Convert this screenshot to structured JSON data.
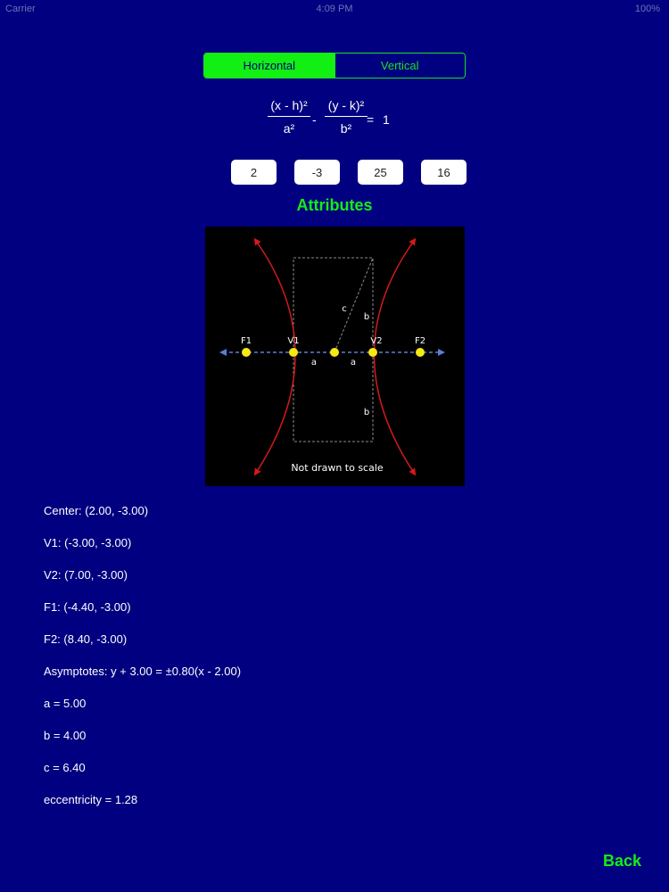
{
  "status": {
    "carrier": "Carrier",
    "time": "4:09 PM",
    "battery": "100%"
  },
  "orientation": {
    "options": [
      "Horizontal",
      "Vertical"
    ],
    "selected": "Horizontal"
  },
  "equation": {
    "term1_numerator": "(x - h)²",
    "term1_denominator": "a²",
    "operator": "-",
    "term2_numerator": "(y - k)²",
    "term2_denominator": "b²",
    "equals": "=",
    "rhs": "1"
  },
  "inputs": {
    "h": "2",
    "k": "-3",
    "a_squared": "25",
    "b_squared": "16"
  },
  "attributes_title": "Attributes",
  "diagram": {
    "labels": {
      "f1": "F1",
      "v1": "V1",
      "v2": "V2",
      "f2": "F2",
      "a_left": "a",
      "a_right": "a",
      "b_upper": "b",
      "b_lower": "b",
      "c": "c"
    },
    "caption": "Not drawn to scale",
    "colors": {
      "curve": "#d41a1a",
      "points": "#f5e90f",
      "axis": "#5b7fd6",
      "box": "#8a8a8a"
    }
  },
  "results": [
    "Center: (2.00, -3.00)",
    "V1: (-3.00, -3.00)",
    "V2: (7.00, -3.00)",
    "F1: (-4.40, -3.00)",
    "F2: (8.40, -3.00)",
    "Asymptotes: y + 3.00 = ±0.80(x - 2.00)",
    "a = 5.00",
    "b = 4.00",
    "c = 6.40",
    "eccentricity = 1.28"
  ],
  "back_label": "Back",
  "colors": {
    "background": "#000080",
    "accent": "#12ef12",
    "text": "#ffffff"
  }
}
